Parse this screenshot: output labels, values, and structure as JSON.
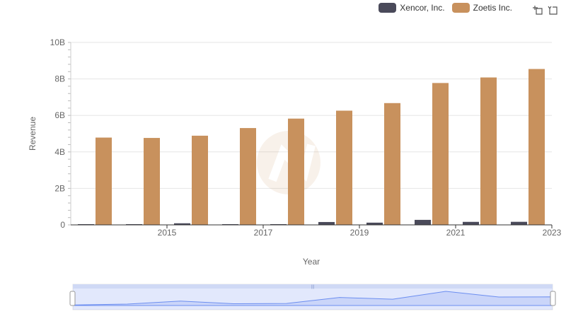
{
  "legend": {
    "items": [
      {
        "label": "Xencor, Inc.",
        "color": "#4a4a5a"
      },
      {
        "label": "Zoetis Inc.",
        "color": "#c8915d"
      }
    ]
  },
  "toolbar": {
    "icons": [
      "zoom-select-icon",
      "zoom-reset-icon"
    ]
  },
  "chart_data": {
    "type": "bar",
    "xlabel": "Year",
    "ylabel": "Revenue",
    "categories": [
      "2014",
      "2015",
      "2016",
      "2017",
      "2018",
      "2019",
      "2020",
      "2021",
      "2022",
      "2023"
    ],
    "x_tick_labels": [
      "2015",
      "2017",
      "2019",
      "2021",
      "2023"
    ],
    "y_tick_labels": [
      "0",
      "2B",
      "4B",
      "6B",
      "8B",
      "10B"
    ],
    "ylim": [
      0,
      10000000000
    ],
    "grid": true,
    "legend_position": "top-right",
    "series": [
      {
        "name": "Xencor, Inc.",
        "color": "#4a4a5a",
        "values": [
          10000000,
          28000000,
          87000000,
          35000000,
          40000000,
          157000000,
          122000000,
          275000000,
          165000000,
          168000000
        ]
      },
      {
        "name": "Zoetis Inc.",
        "color": "#c8915d",
        "values": [
          4785000000,
          4765000000,
          4888000000,
          5307000000,
          5825000000,
          6260000000,
          6675000000,
          7776000000,
          8080000000,
          8544000000
        ]
      }
    ]
  },
  "brush": {
    "color": "#6c8ef0"
  }
}
